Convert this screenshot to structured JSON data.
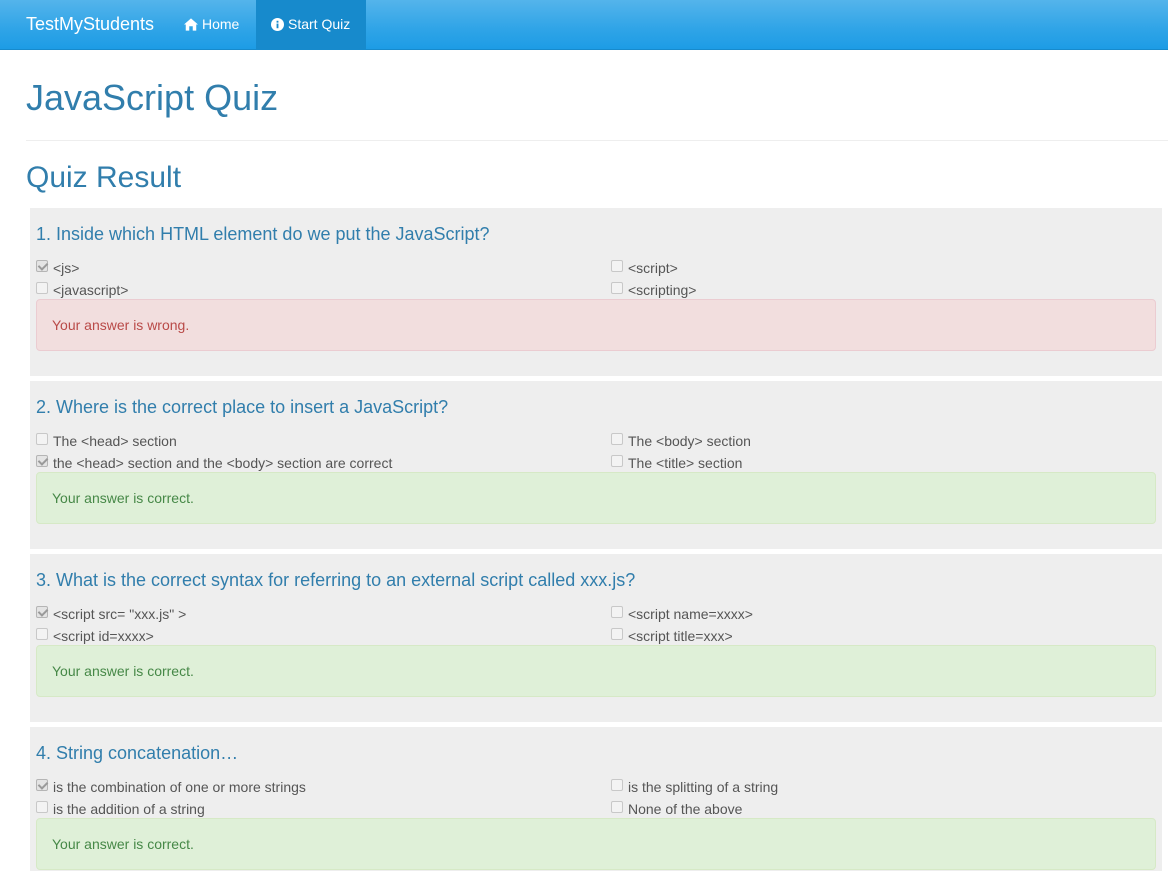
{
  "navbar": {
    "brand": "TestMyStudents",
    "home_label": "Home",
    "start_quiz_label": "Start Quiz",
    "icons": {
      "home": "home-icon",
      "start_quiz": "info-circle-icon"
    }
  },
  "page": {
    "title": "JavaScript Quiz",
    "section_title": "Quiz Result"
  },
  "questions": [
    {
      "title": "1. Inside which HTML element do we put the JavaScript?",
      "options": [
        {
          "label": "<js>",
          "checked": true
        },
        {
          "label": "<script>",
          "checked": false
        },
        {
          "label": "<javascript>",
          "checked": false
        },
        {
          "label": "<scripting>",
          "checked": false
        }
      ],
      "result": "Your answer is wrong.",
      "status": "wrong"
    },
    {
      "title": "2. Where is the correct place to insert a JavaScript?",
      "options": [
        {
          "label": "The <head> section",
          "checked": false
        },
        {
          "label": "The <body> section",
          "checked": false
        },
        {
          "label": "the <head> section and the <body> section are correct",
          "checked": true
        },
        {
          "label": "The <title> section",
          "checked": false
        }
      ],
      "result": "Your answer is correct.",
      "status": "correct"
    },
    {
      "title": "3. What is the correct syntax for referring to an external script called xxx.js?",
      "options": [
        {
          "label": "<script src= \"xxx.js\" >",
          "checked": true
        },
        {
          "label": "<script name=xxxx>",
          "checked": false
        },
        {
          "label": "<script id=xxxx>",
          "checked": false
        },
        {
          "label": "<script title=xxx>",
          "checked": false
        }
      ],
      "result": "Your answer is correct.",
      "status": "correct"
    },
    {
      "title": "4. String concatenation…",
      "options": [
        {
          "label": "is the combination of one or more strings",
          "checked": true
        },
        {
          "label": "is the splitting of a string",
          "checked": false
        },
        {
          "label": "is the addition of a string",
          "checked": false
        },
        {
          "label": "None of the above",
          "checked": false
        }
      ],
      "result": "Your answer is correct.",
      "status": "correct"
    }
  ],
  "colors": {
    "navbar": "#2fa4e7",
    "navbar_active": "#178acc",
    "heading": "#317eac",
    "question_bg": "#eeeeee",
    "wrong_bg": "#f2dede",
    "wrong_text": "#b94a48",
    "correct_bg": "#dff0d8",
    "correct_text": "#468847"
  }
}
